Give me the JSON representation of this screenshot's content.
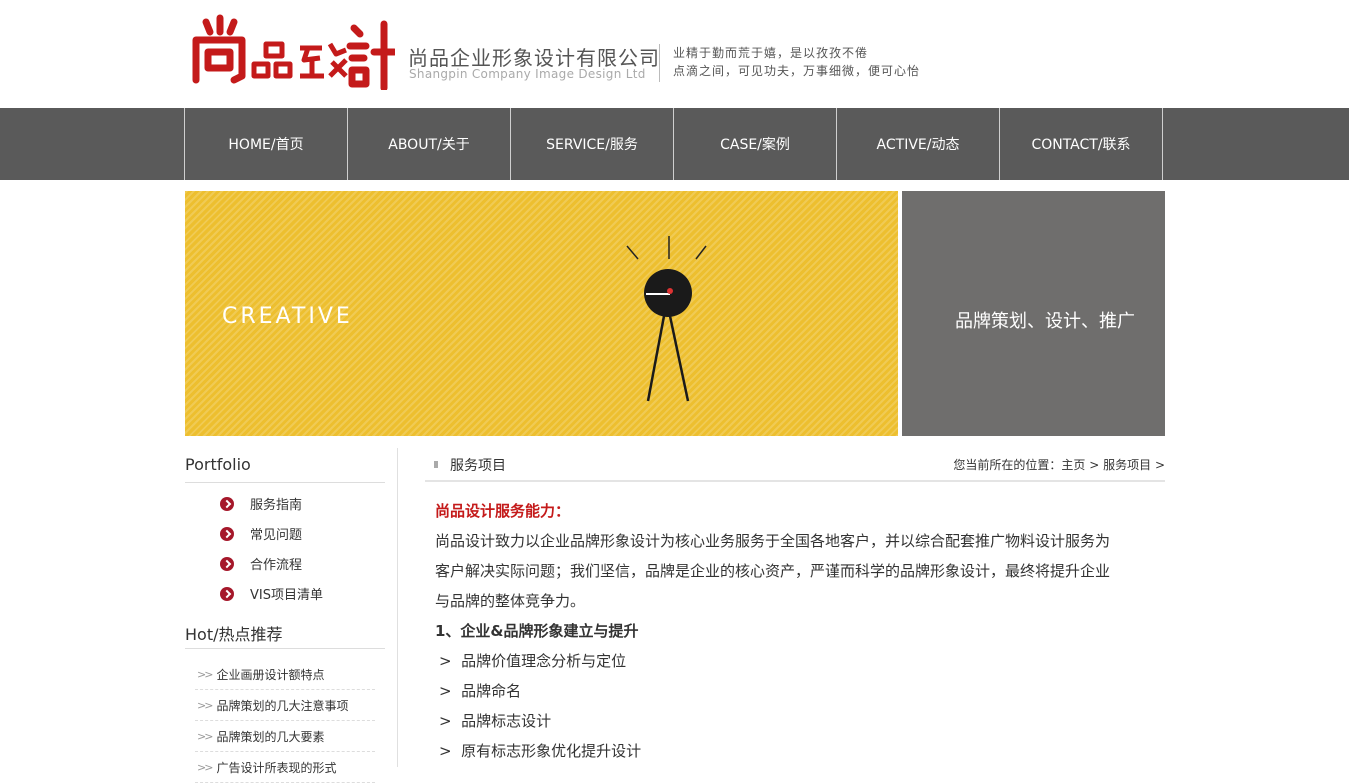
{
  "header": {
    "company_name": "尚品企业形象设计有限公司",
    "company_name_en": "Shangpin Company Image Design Ltd",
    "motto_line1": "业精于勤而荒于嬉，是以孜孜不倦",
    "motto_line2": "点滴之间，可见功夫，万事细微，便可心怡",
    "brand_color": "#c41a1a"
  },
  "nav": {
    "items": [
      "HOME/首页",
      "ABOUT/关于",
      "SERVICE/服务",
      "CASE/案例",
      "ACTIVE/动态",
      "CONTACT/联系"
    ]
  },
  "banner": {
    "creative": "CREATIVE",
    "slogan": "品牌策划、设计、推广",
    "accent_color": "#edbf2f"
  },
  "sidebar": {
    "portfolio_title": "Portfolio",
    "services": [
      "服务指南",
      "常见问题",
      "合作流程",
      "VIS项目清单"
    ],
    "hot_title": "Hot/热点推荐",
    "hot": [
      "企业画册设计额特点",
      "品牌策划的几大注意事项",
      "品牌策划的几大要素",
      "广告设计所表现的形式"
    ]
  },
  "main": {
    "title": "服务项目",
    "breadcrumb_prefix": "您当前所在的位置：",
    "breadcrumb_home": "主页",
    "breadcrumb_sep": " > ",
    "breadcrumb_current": "服务项目",
    "breadcrumb_tail": " >",
    "heading": "尚品设计服务能力：",
    "paragraph_1": "尚品设计致力以企业品牌形象设计为核心业务服务于全国各地客户，并以综合配套推广物料设计服务为",
    "paragraph_2": "客户解决实际问题；我们坚信，品牌是企业的核心资产，严谨而科学的品牌形象设计，最终将提升企业",
    "paragraph_3": "与品牌的整体竞争力。",
    "section_title": "1、企业&品牌形象建立与提升",
    "bullets": [
      "品牌价值理念分析与定位",
      "品牌命名",
      "品牌标志设计",
      "原有标志形象优化提升设计"
    ]
  }
}
